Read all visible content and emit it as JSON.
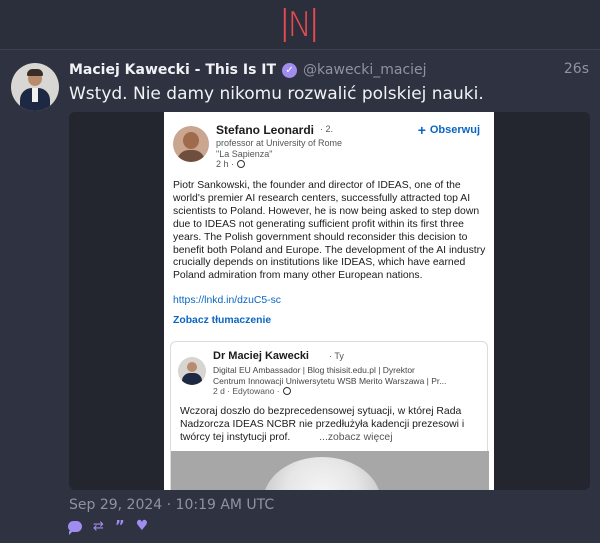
{
  "app": {
    "logo_text": "N",
    "accent": "#e94a52",
    "action_color": "#a18cf0"
  },
  "tweet": {
    "author_name": "Maciej Kawecki - This Is IT",
    "verified_icon": "check-badge-icon",
    "handle": "@kawecki_maciej",
    "age": "26s",
    "text": "Wstyd. Nie damy nikomu rozwalić polskiej nauki.",
    "timestamp": "Sep 29, 2024 · 10:19 AM UTC"
  },
  "embedded_post": {
    "author": "Stefano Leonardi",
    "degree": "· 2.",
    "follow_label": "Obserwuj",
    "headline_line1": "professor at University of Rome",
    "headline_line2": "\"La Sapienza\"",
    "age": "2 h ·",
    "body": "Piotr Sankowski, the founder and director of IDEAS, one of the world's premier AI research centers, successfully attracted top AI scientists to  Poland. However, he is now being asked to step down due to IDEAS not generating sufficient profit within its first three years. The Polish government should reconsider this decision to benefit both Poland and Europe. The development of the AI industry crucially depends on institutions like IDEAS, which have earned Poland admiration from many other European nations.",
    "link": "https://lnkd.in/dzuC5-sc",
    "translate_label": "Zobacz tłumaczenie",
    "shared": {
      "author": "Dr Maciej Kawecki",
      "degree": "· Ty",
      "headline_line1": "Digital EU Ambassador | Blog thisisit.edu.pl | Dyrektor",
      "headline_line2": "Centrum Innowacji Uniwersytetu WSB Merito Warszawa | Pr...",
      "age": "2 d · Edytowano ·",
      "body": "Wczoraj doszło do bezprecedensowej sytuacji, w której Rada Nadzorcza IDEAS NCBR nie przedłużyła kadencji prezesowi i twórcy tej instytucji prof.",
      "more_label": "...zobacz więcej"
    }
  }
}
